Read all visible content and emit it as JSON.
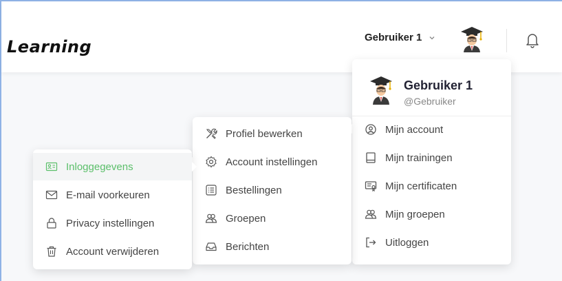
{
  "header": {
    "logo": "Learning",
    "user_name": "Gebruiker 1"
  },
  "profile": {
    "name": "Gebruiker 1",
    "handle": "@Gebruiker"
  },
  "main_menu": [
    {
      "label": "Mijn account",
      "icon": "user-circle-icon"
    },
    {
      "label": "Mijn trainingen",
      "icon": "book-icon"
    },
    {
      "label": "Mijn certificaten",
      "icon": "certificate-icon"
    },
    {
      "label": "Mijn groepen",
      "icon": "users-icon"
    },
    {
      "label": "Uitloggen",
      "icon": "logout-icon"
    }
  ],
  "account_menu": [
    {
      "label": "Profiel bewerken",
      "icon": "tools-icon"
    },
    {
      "label": "Account instellingen",
      "icon": "gear-icon"
    },
    {
      "label": "Bestellingen",
      "icon": "list-icon"
    },
    {
      "label": "Groepen",
      "icon": "users-icon"
    },
    {
      "label": "Berichten",
      "icon": "inbox-icon"
    }
  ],
  "settings_menu": [
    {
      "label": "Inloggegevens",
      "icon": "id-card-icon",
      "active": true
    },
    {
      "label": "E-mail voorkeuren",
      "icon": "mail-icon"
    },
    {
      "label": "Privacy instellingen",
      "icon": "lock-icon"
    },
    {
      "label": "Account verwijderen",
      "icon": "trash-icon"
    }
  ],
  "colors": {
    "accent": "#5bbf6a",
    "border": "#8fb3e6"
  }
}
